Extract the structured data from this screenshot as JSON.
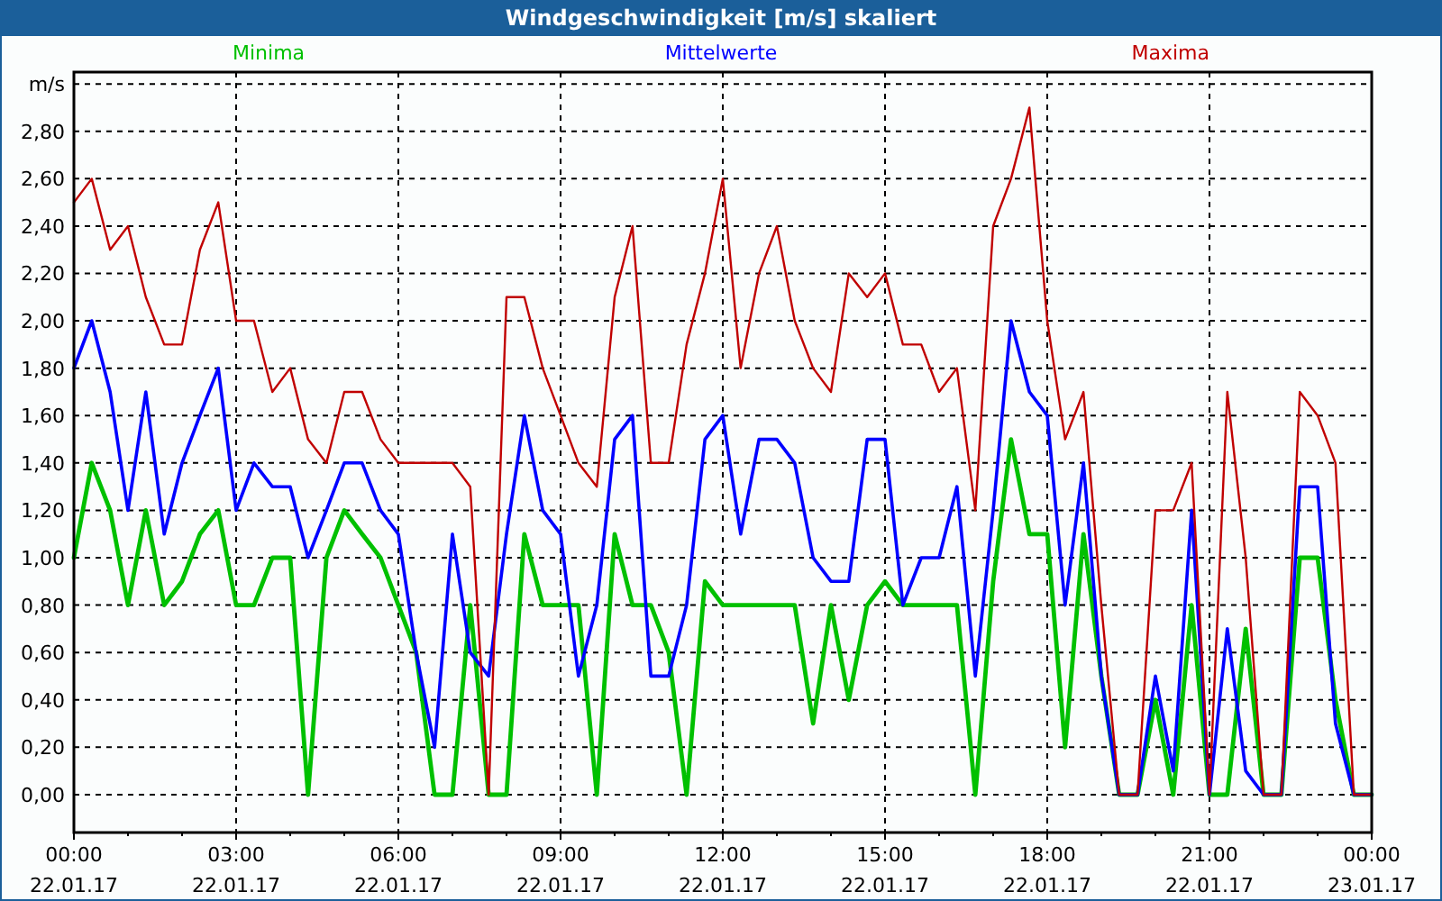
{
  "window": {
    "title": "Windgeschwindigkeit [m/s] skaliert"
  },
  "chart": {
    "chart_data": {
      "type": "line",
      "ylabel": "m/s",
      "x": [
        0,
        0.33,
        0.67,
        1,
        1.33,
        1.67,
        2,
        2.33,
        2.67,
        3,
        3.33,
        3.67,
        4,
        4.33,
        4.67,
        5,
        5.33,
        5.67,
        6,
        6.33,
        6.67,
        7,
        7.33,
        7.67,
        8,
        8.33,
        8.67,
        9,
        9.33,
        9.67,
        10,
        10.33,
        10.67,
        11,
        11.33,
        11.67,
        12,
        12.33,
        12.67,
        13,
        13.33,
        13.67,
        14,
        14.33,
        14.67,
        15,
        15.33,
        15.67,
        16,
        16.33,
        16.67,
        17,
        17.33,
        17.67,
        18,
        18.33,
        18.67,
        19,
        19.33,
        19.67,
        20,
        20.33,
        20.67,
        21,
        21.33,
        21.67,
        22,
        22.33,
        22.67,
        23,
        23.33,
        23.67,
        24
      ],
      "xlim": [
        0,
        24
      ],
      "ylim": [
        -0.16,
        3.05
      ],
      "grid": true,
      "xticks": [
        {
          "value": 0,
          "label": "00:00"
        },
        {
          "value": 3,
          "label": "03:00"
        },
        {
          "value": 6,
          "label": "06:00"
        },
        {
          "value": 9,
          "label": "09:00"
        },
        {
          "value": 12,
          "label": "12:00"
        },
        {
          "value": 15,
          "label": "15:00"
        },
        {
          "value": 18,
          "label": "18:00"
        },
        {
          "value": 21,
          "label": "21:00"
        },
        {
          "value": 24,
          "label": "00:00"
        }
      ],
      "annotations": [
        "22.01.17",
        "22.01.17",
        "22.01.17",
        "22.01.17",
        "22.01.17",
        "22.01.17",
        "22.01.17",
        "22.01.17",
        "23.01.17"
      ],
      "yticks": [
        {
          "value": 0,
          "label": "0,00"
        },
        {
          "value": 0.2,
          "label": "0,20"
        },
        {
          "value": 0.4,
          "label": "0,40"
        },
        {
          "value": 0.6,
          "label": "0,60"
        },
        {
          "value": 0.8,
          "label": "0,80"
        },
        {
          "value": 1,
          "label": "1,00"
        },
        {
          "value": 1.2,
          "label": "1,20"
        },
        {
          "value": 1.4,
          "label": "1,40"
        },
        {
          "value": 1.6,
          "label": "1,60"
        },
        {
          "value": 1.8,
          "label": "1,80"
        },
        {
          "value": 2,
          "label": "2,00"
        },
        {
          "value": 2.2,
          "label": "2,20"
        },
        {
          "value": 2.4,
          "label": "2,40"
        },
        {
          "value": 2.6,
          "label": "2,60"
        },
        {
          "value": 2.8,
          "label": "2,80"
        }
      ],
      "series": [
        {
          "name": "Minima",
          "color": "#00c000",
          "values": [
            1.0,
            1.4,
            1.2,
            0.8,
            1.2,
            0.8,
            0.9,
            1.1,
            1.2,
            0.8,
            0.8,
            1.0,
            1.0,
            0.0,
            1.0,
            1.2,
            1.1,
            1.0,
            0.8,
            0.6,
            0.0,
            0.0,
            0.8,
            0.0,
            0.0,
            1.1,
            0.8,
            0.8,
            0.8,
            0.0,
            1.1,
            0.8,
            0.8,
            0.6,
            0.0,
            0.9,
            0.8,
            0.8,
            0.8,
            0.8,
            0.8,
            0.3,
            0.8,
            0.4,
            0.8,
            0.9,
            0.8,
            0.8,
            0.8,
            0.8,
            0.0,
            0.9,
            1.5,
            1.1,
            1.1,
            0.2,
            1.1,
            0.5,
            0,
            0,
            0.4,
            0.0,
            0.8,
            0,
            0,
            0.7,
            0,
            0,
            1.0,
            1.0,
            0.4,
            0,
            0
          ]
        },
        {
          "name": "Mittelwerte",
          "color": "#0000ff",
          "values": [
            1.8,
            2.0,
            1.7,
            1.2,
            1.7,
            1.1,
            1.4,
            1.6,
            1.8,
            1.2,
            1.4,
            1.3,
            1.3,
            1.0,
            1.2,
            1.4,
            1.4,
            1.2,
            1.1,
            0.6,
            0.2,
            1.1,
            0.6,
            0.5,
            1.1,
            1.6,
            1.2,
            1.1,
            0.5,
            0.8,
            1.5,
            1.6,
            0.5,
            0.5,
            0.8,
            1.5,
            1.6,
            1.1,
            1.5,
            1.5,
            1.4,
            1.0,
            0.9,
            0.9,
            1.5,
            1.5,
            0.8,
            1.0,
            1.0,
            1.3,
            0.5,
            1.2,
            2.0,
            1.7,
            1.6,
            0.8,
            1.4,
            0.5,
            0,
            0,
            0.5,
            0.1,
            1.2,
            0,
            0.7,
            0.1,
            0,
            0,
            1.3,
            1.3,
            0.3,
            0,
            0
          ]
        },
        {
          "name": "Maxima",
          "color": "#c00000",
          "values": [
            2.5,
            2.6,
            2.3,
            2.4,
            2.1,
            1.9,
            1.9,
            2.3,
            2.5,
            2.0,
            2.0,
            1.7,
            1.8,
            1.5,
            1.4,
            1.7,
            1.7,
            1.5,
            1.4,
            1.4,
            1.4,
            1.4,
            1.3,
            0.0,
            2.1,
            2.1,
            1.8,
            1.6,
            1.4,
            1.3,
            2.1,
            2.4,
            1.4,
            1.4,
            1.9,
            2.2,
            2.6,
            1.8,
            2.2,
            2.4,
            2.0,
            1.8,
            1.7,
            2.2,
            2.1,
            2.2,
            1.9,
            1.9,
            1.7,
            1.8,
            1.2,
            2.4,
            2.6,
            2.9,
            2.0,
            1.5,
            1.7,
            0.8,
            0,
            0,
            1.2,
            1.2,
            1.4,
            0,
            1.7,
            1.0,
            0,
            0,
            1.7,
            1.6,
            1.4,
            0,
            0
          ]
        }
      ]
    }
  }
}
